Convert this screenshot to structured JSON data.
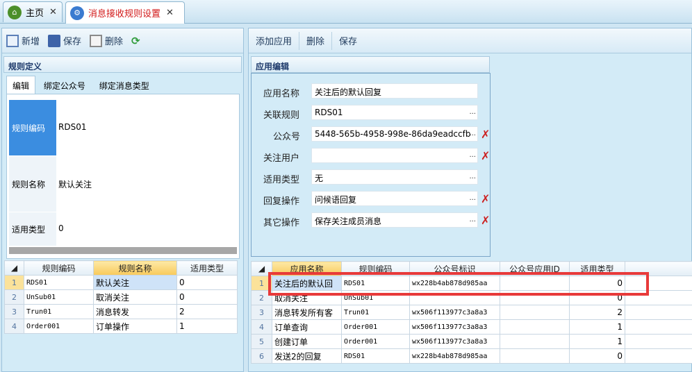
{
  "tabs": [
    {
      "label": "主页",
      "close": "✕"
    },
    {
      "label": "消息接收规则设置",
      "close": "✕"
    }
  ],
  "left": {
    "toolbar": {
      "add": "新增",
      "save": "保存",
      "delete": "删除"
    },
    "group_title": "规则定义",
    "form_tabs": [
      "编辑",
      "绑定公众号",
      "绑定消息类型"
    ],
    "fields": [
      {
        "label": "规则编码",
        "value": "RDS01"
      },
      {
        "label": "规则名称",
        "value": "默认关注"
      },
      {
        "label": "适用类型",
        "value": "0"
      }
    ],
    "grid": {
      "headers": [
        "规则编码",
        "规则名称",
        "适用类型"
      ],
      "rows": [
        [
          "1",
          "RDS01",
          "默认关注",
          "0"
        ],
        [
          "2",
          "UnSub01",
          "取消关注",
          "0"
        ],
        [
          "3",
          "Trun01",
          "消息转发",
          "2"
        ],
        [
          "4",
          "Order001",
          "订单操作",
          "1"
        ]
      ]
    }
  },
  "right": {
    "toolbar": {
      "add": "添加应用",
      "delete": "删除",
      "save": "保存"
    },
    "group_title": "应用编辑",
    "fields": [
      {
        "label": "应用名称",
        "value": "关注后的默认回复"
      },
      {
        "label": "关联规则",
        "value": "RDS01",
        "dots": "..."
      },
      {
        "label": "公众号",
        "value": "5448-565b-4958-998e-86da9eadccfb",
        "dots": "..."
      },
      {
        "label": "关注用户",
        "value": "",
        "dots": "..."
      },
      {
        "label": "适用类型",
        "value": "无",
        "dots": "..."
      },
      {
        "label": "回复操作",
        "value": "问候语回复",
        "dots": "..."
      },
      {
        "label": "其它操作",
        "value": "保存关注成员消息",
        "dots": "..."
      }
    ],
    "grid": {
      "headers": [
        "应用名称",
        "规则编码",
        "公众号标识",
        "公众号应用ID",
        "适用类型"
      ],
      "rows": [
        [
          "1",
          "关注后的默认回",
          "RDS01",
          "wx228b4ab878d985aa",
          "",
          "0"
        ],
        [
          "2",
          "取消关注",
          "UnSub01",
          "",
          "",
          "0"
        ],
        [
          "3",
          "消息转发所有客",
          "Trun01",
          "wx506f113977c3a8a3",
          "",
          "2"
        ],
        [
          "4",
          "订单查询",
          "Order001",
          "wx506f113977c3a8a3",
          "",
          "1"
        ],
        [
          "5",
          "创建订单",
          "Order001",
          "wx506f113977c3a8a3",
          "",
          "1"
        ],
        [
          "6",
          "发送2的回复",
          "RDS01",
          "wx228b4ab878d985aa",
          "",
          "0"
        ]
      ]
    }
  },
  "colors": {
    "accent": "#e83a3a",
    "selected": "#3b8de0"
  }
}
